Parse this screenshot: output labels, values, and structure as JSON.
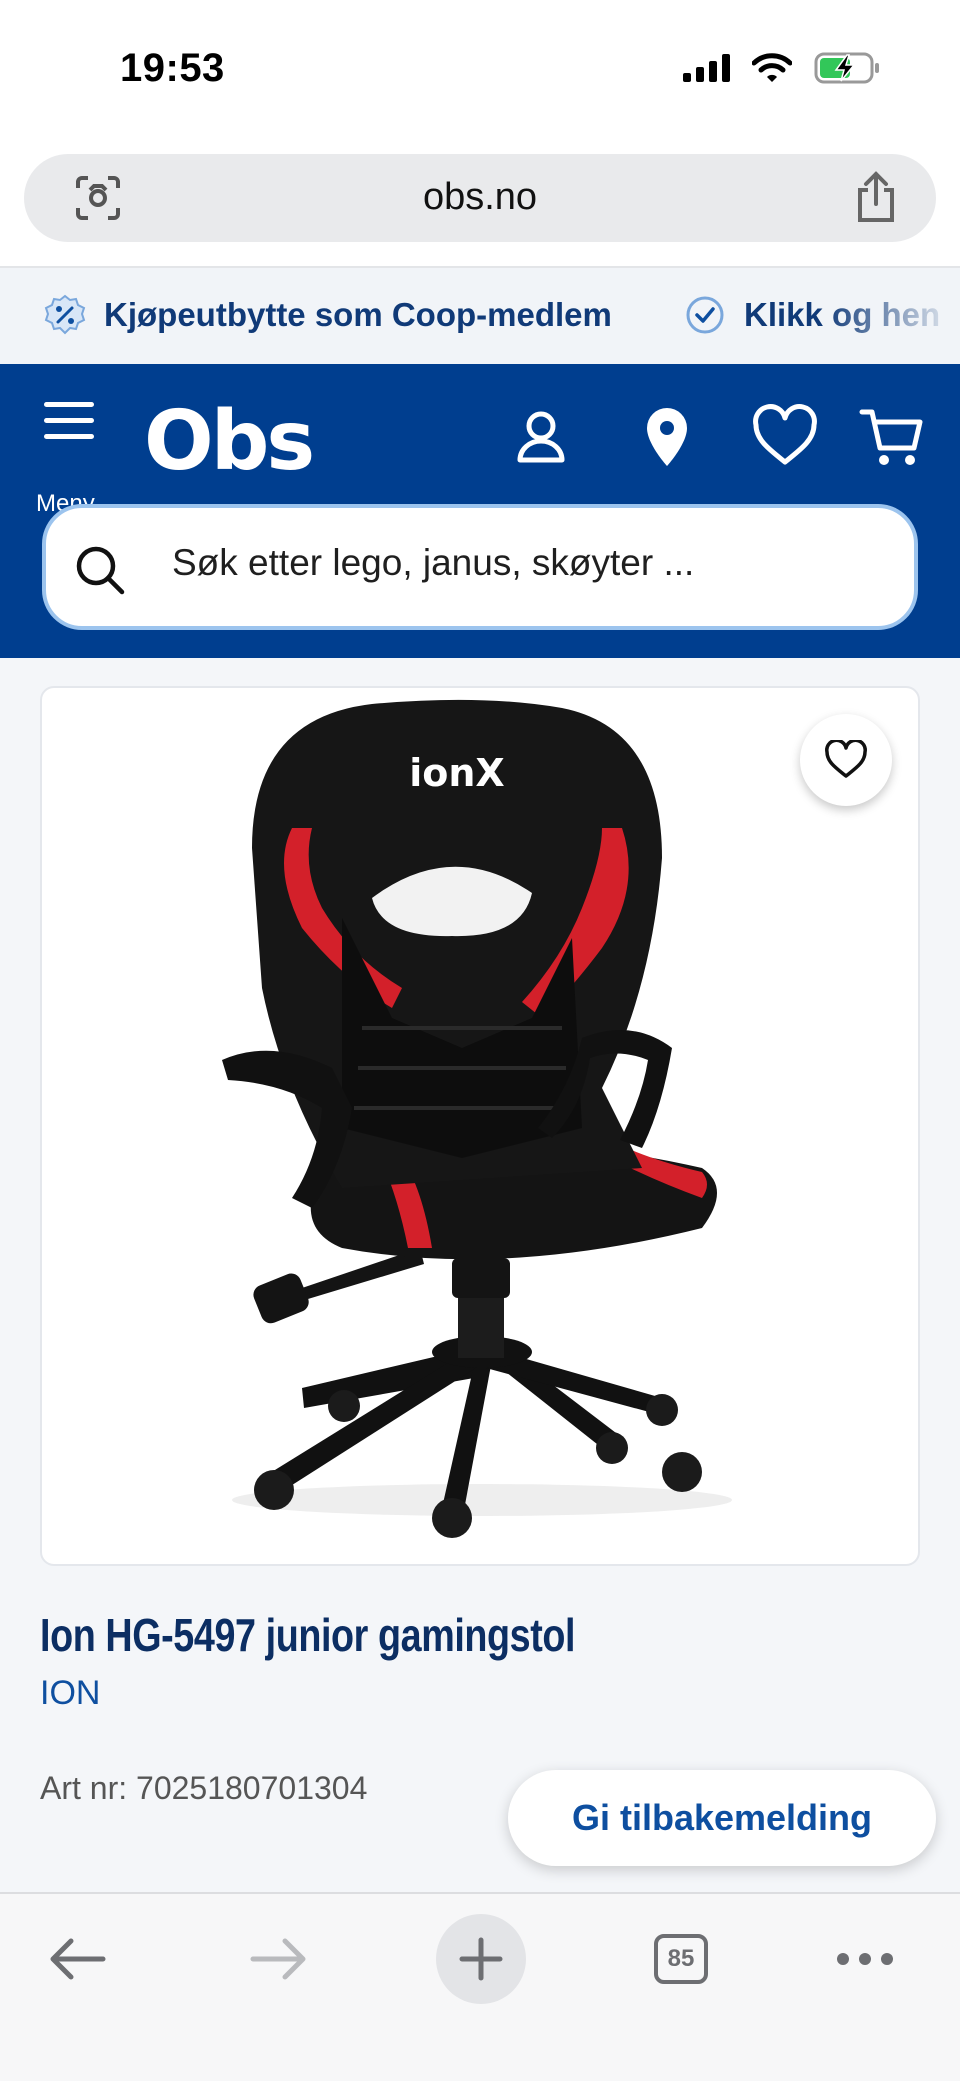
{
  "status_bar": {
    "time": "19:53"
  },
  "browser": {
    "url": "obs.no",
    "tab_count": "85"
  },
  "promo": {
    "items": [
      {
        "label": "Kjøpeutbytte som Coop-medlem",
        "icon": "percent-badge-icon"
      },
      {
        "label": "Klikk og hen",
        "icon": "check-circle-icon"
      }
    ]
  },
  "header": {
    "menu_label": "Meny",
    "logo": "Obs",
    "search_placeholder": "Søk etter lego, janus, skøyter ..."
  },
  "product": {
    "image_label": "ionX",
    "title": "Ion HG-5497 junior gamingstol",
    "brand": "ION",
    "art_nr": "Art nr: 7025180701304"
  },
  "actions": {
    "feedback_label": "Gi tilbakemelding"
  },
  "colors": {
    "brand_blue": "#003e8f",
    "text_blue": "#0e4fa0",
    "chair_red": "#d3202a"
  }
}
